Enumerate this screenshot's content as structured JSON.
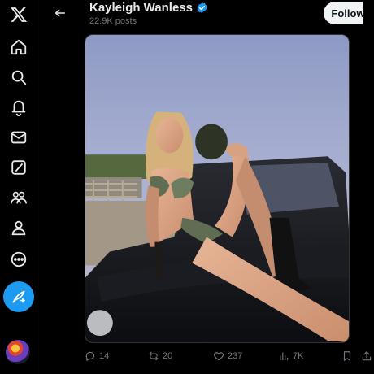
{
  "header": {
    "name": "Kayleigh Wanless",
    "post_count": "22.9K posts",
    "follow_label": "Follow"
  },
  "nav": [
    {
      "icon": "x-logo-icon"
    },
    {
      "icon": "home-icon"
    },
    {
      "icon": "search-icon"
    },
    {
      "icon": "notifications-icon"
    },
    {
      "icon": "messages-icon"
    },
    {
      "icon": "grok-icon"
    },
    {
      "icon": "communities-icon"
    },
    {
      "icon": "profile-icon"
    },
    {
      "icon": "more-icon"
    }
  ],
  "post_button": {
    "icon": "compose-icon"
  },
  "post": {
    "replies": "14",
    "reposts": "20",
    "likes": "237",
    "views": "7K"
  },
  "colors": {
    "accent": "#1d9bf0",
    "background": "#000000",
    "text": "#e7e9ea",
    "muted": "#71767b"
  }
}
